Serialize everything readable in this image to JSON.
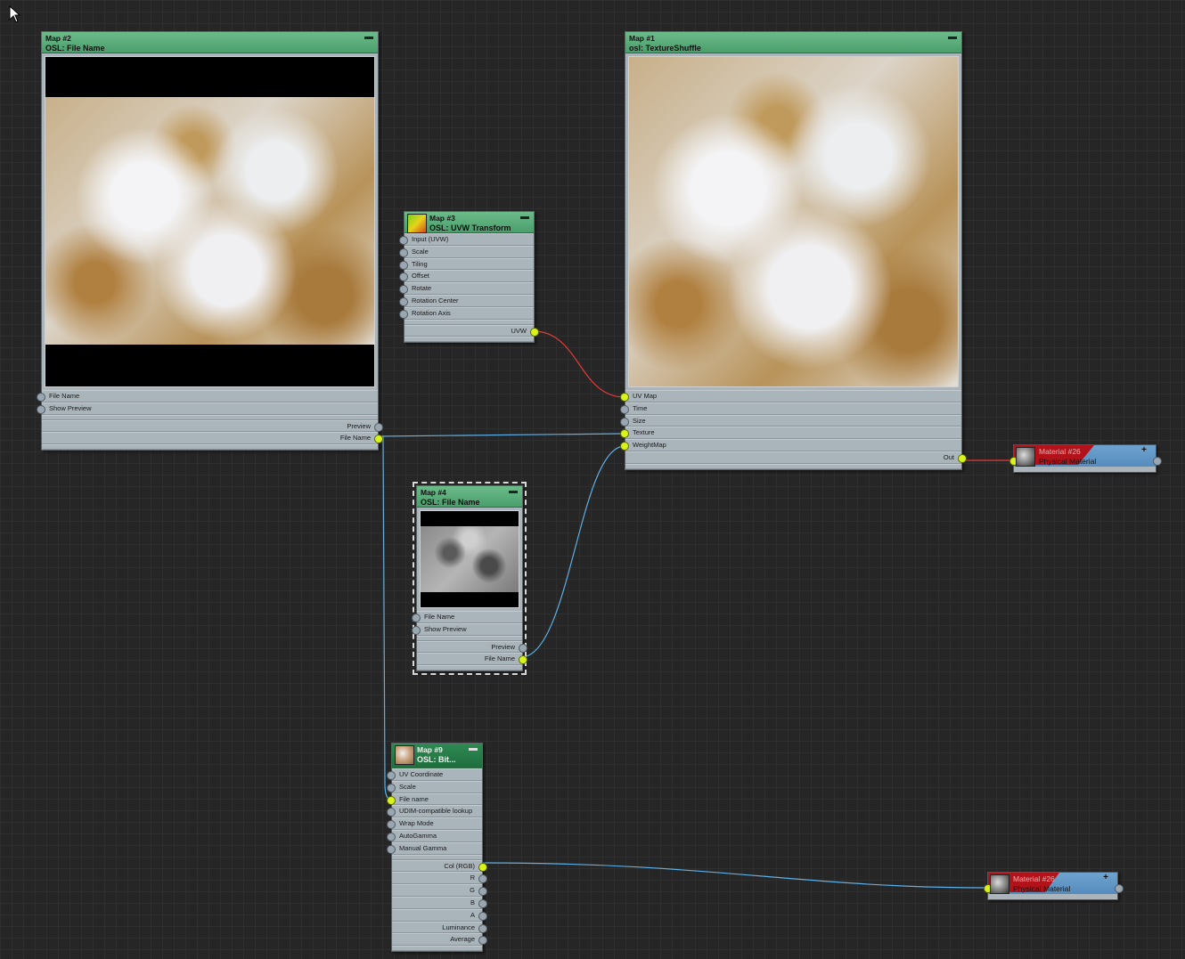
{
  "nodes": {
    "map2": {
      "title": "Map #2",
      "subtitle": "OSL: File Name",
      "inputs": [
        "File Name",
        "Show Preview"
      ],
      "outputs": [
        "Preview",
        "File Name"
      ]
    },
    "map3": {
      "title": "Map #3",
      "subtitle": "OSL: UVW Transform",
      "inputs": [
        "Input (UVW)",
        "Scale",
        "Tiling",
        "Offset",
        "Rotate",
        "Rotation Center",
        "Rotation Axis"
      ],
      "outputs": [
        "UVW"
      ]
    },
    "map1": {
      "title": "Map #1",
      "subtitle": "osl: TextureShuffle",
      "inputs": [
        "UV Map",
        "Time",
        "Size",
        "Texture",
        "WeightMap"
      ],
      "outputs": [
        "Out"
      ]
    },
    "map4": {
      "title": "Map #4",
      "subtitle": "OSL: File Name",
      "inputs": [
        "File Name",
        "Show Preview"
      ],
      "outputs": [
        "Preview",
        "File Name"
      ]
    },
    "map9": {
      "title": "Map #9",
      "subtitle": "OSL: Bit...",
      "inputs": [
        "UV Coordinate",
        "Scale",
        "File name",
        "UDIM-compatible lookup",
        "Wrap Mode",
        "AutoGamma",
        "Manual Gamma"
      ],
      "outputs": [
        "Col (RGB)",
        "R",
        "G",
        "B",
        "A",
        "Luminance",
        "Average"
      ]
    }
  },
  "materials": {
    "mat1": {
      "title": "Material #26",
      "subtitle": "Physical Material"
    },
    "mat2": {
      "title": "Material #26",
      "subtitle": "Physical Material"
    }
  },
  "icons": {
    "minimize": "minimize-icon",
    "expand": "plus-icon",
    "cursor": "mouse-cursor-icon"
  },
  "colors": {
    "background": "#262626",
    "header": "#5aaf7a",
    "body": "#aab4bb",
    "socket_active": "#d9f21c",
    "wire_blue": "#5fb0e6",
    "wire_red": "#e23a3a",
    "material_blue": "#5f95c4",
    "material_red": "#b3121a"
  }
}
